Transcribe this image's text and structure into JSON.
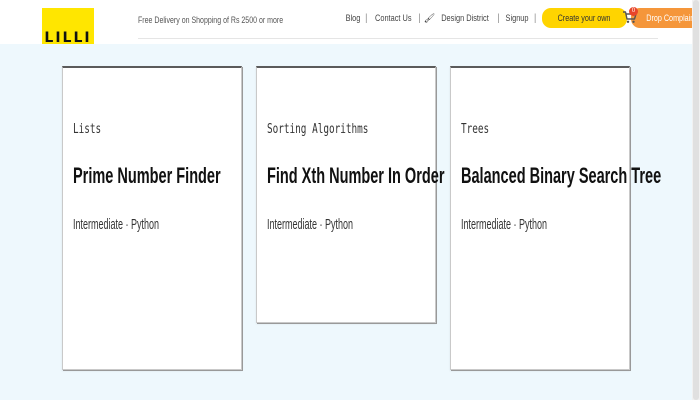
{
  "header": {
    "logo_text": "LILLI",
    "delivery_text": "Free Delivery on Shopping of Rs 2500 or more",
    "nav": {
      "blog": "Blog",
      "contact": "Contact Us",
      "design_district": "Design District",
      "signup": "Signup"
    },
    "create_button": "Create your own",
    "drop_button": "Drop Complaint",
    "cart_count": "0"
  },
  "cards": [
    {
      "category": "Lists",
      "title": "Prime Number Finder",
      "meta": "Intermediate · Python"
    },
    {
      "category": "Sorting Algorithms",
      "title": "Find Xth Number In Order",
      "meta": "Intermediate · Python"
    },
    {
      "category": "Trees",
      "title": "Balanced Binary Search Tree",
      "meta": "Intermediate · Python"
    }
  ],
  "colors": {
    "accent_yellow": "#ffd400",
    "accent_orange": "#f5963a",
    "badge_red": "#e8452a",
    "page_bg": "#eef8fd"
  }
}
